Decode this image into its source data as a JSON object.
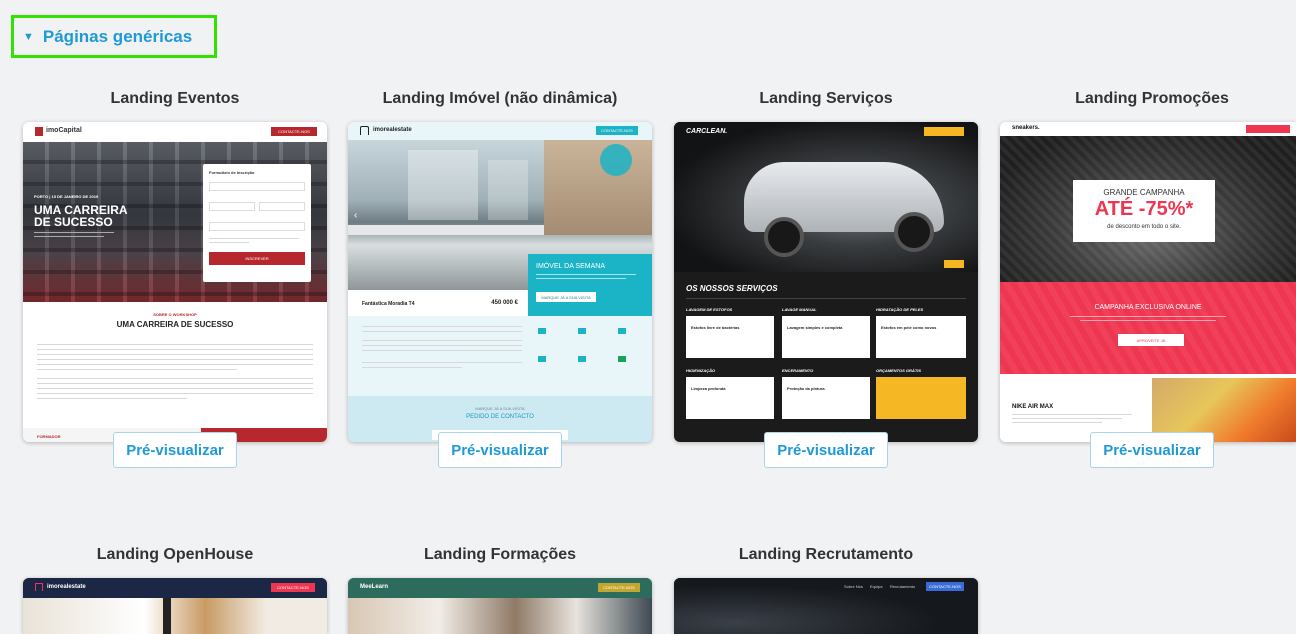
{
  "section": {
    "title": "Páginas genéricas",
    "caret": "▼"
  },
  "cards": [
    {
      "name": "Landing Eventos",
      "preview_label": "Pré-visualizar",
      "thumb": {
        "brand": "imoCapital",
        "cta": "CONTACTE-NOS",
        "date": "PORTO | 15 DE JANEIRO DE 2019",
        "hero_title_1": "UMA CARREIRA",
        "hero_title_2": "DE SUCESSO",
        "form_title": "Formulário de Inscrição",
        "form_button": "INSCREVER",
        "kicker": "SOBRE O WORKSHOP",
        "section_title": "UMA CARREIRA DE SUCESSO",
        "footer_left": "FORMADOR",
        "footer_right": "LOCAL"
      }
    },
    {
      "name": "Landing Imóvel (não dinâmica)",
      "preview_label": "Pré-visualizar",
      "thumb": {
        "brand": "imorealestate",
        "cta": "CONTACTE-NOS",
        "week_title": "IMÓVEL DA SEMANA",
        "week_button": "MARQUE JÁ A SUA VISITA",
        "prop_label": "Fantástica Moradia T4",
        "price": "450 000 €",
        "visit_kicker": "MARQUE JÁ A SUA VISITA",
        "visit_title": "PEDIDO DE CONTACTO"
      }
    },
    {
      "name": "Landing Serviços",
      "preview_label": "Pré-visualizar",
      "thumb": {
        "brand": "CARCLEAN.",
        "section_title": "OS NOSSOS SERVIÇOS",
        "cols": [
          "LAVAGEM DE ESTOFOS",
          "LAVAGE MANUAL",
          "HIDRATAÇÃO DE PELES"
        ],
        "cols2": [
          "HIGIENIZAÇÃO",
          "ENCERAMENTO",
          "ORÇAMENTOS GRÁTIS"
        ],
        "items": [
          "Estofos livre de bactérias",
          "Lavagem simples e completa",
          "Estofos em pele como novos",
          "Limpeza profunda",
          "Proteção da pintura"
        ]
      }
    },
    {
      "name": "Landing Promoções",
      "preview_label": "Pré-visualizar",
      "thumb": {
        "brand": "sneakers.",
        "campaign": "GRANDE CAMPANHA",
        "discount": "ATÉ -75%*",
        "discount_sub": "de desconto em todo o site.",
        "online": "CAMPANHA EXCLUSIVA ONLINE",
        "online_btn": "APROVEITE JÁ",
        "product": "NIKE AIR MAX"
      }
    },
    {
      "name": "Landing OpenHouse",
      "thumb": {
        "brand": "imorealestate",
        "cta": "CONTACTE-NOS"
      }
    },
    {
      "name": "Landing Formações",
      "thumb": {
        "brand": "MeeLearn",
        "cta": "CONTACTE-NOS"
      }
    },
    {
      "name": "Landing Recrutamento",
      "thumb": {
        "nav": [
          "Sobre Nós",
          "Equipa",
          "Recrutamento"
        ],
        "cta": "CONTACTE-NOS"
      }
    }
  ],
  "colors": {
    "accent": "#1f9ad6",
    "highlight_border": "#31e300",
    "eventos_red": "#b7282e",
    "imovel_teal": "#1bb3c6",
    "servicos_yellow": "#f5b723",
    "promo_red": "#ef3651"
  }
}
